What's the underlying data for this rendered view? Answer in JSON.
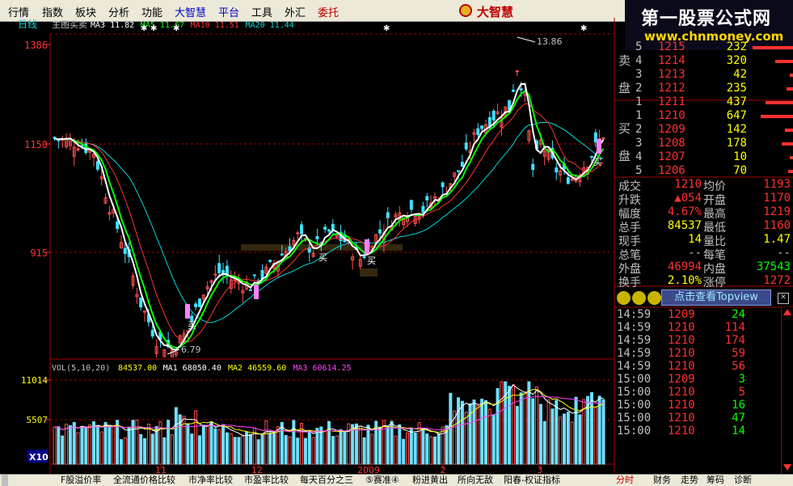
{
  "menu": [
    "行情",
    "指数",
    "板块",
    "分析",
    "功能",
    "大智慧",
    "平台",
    "工具",
    "外汇",
    "委托"
  ],
  "brand": "大智慧",
  "watermark": {
    "line1": "第一股票公式网",
    "line2": "www.chnmoney.com"
  },
  "chart_data": [
    {
      "type": "line",
      "panel": "price",
      "period_label": "日线",
      "title": "主图买卖",
      "legend": [
        {
          "name": "MA3",
          "value": "11.82",
          "color": "#ffffff"
        },
        {
          "name": "MA5",
          "value": "11.67",
          "color": "#00ff00"
        },
        {
          "name": "MA10",
          "value": "11.51",
          "color": "#ff3030"
        },
        {
          "name": "MA20",
          "value": "11.44",
          "color": "#00d8d8"
        }
      ],
      "y_ticks": [
        "1386",
        "1150",
        "915"
      ],
      "high_label": "13.86",
      "low_label": "6.79",
      "signal_label": "买",
      "x_ticks": [
        "11",
        "12",
        "2009",
        "2",
        "3"
      ]
    },
    {
      "type": "bar",
      "panel": "volume",
      "title": "VOL(5,10,20)",
      "legend": [
        {
          "name": "",
          "value": "84537.00",
          "color": "#ffff00"
        },
        {
          "name": "MA1",
          "value": "68050.40",
          "color": "#ffffff"
        },
        {
          "name": "MA2",
          "value": "46559.60",
          "color": "#ffff00"
        },
        {
          "name": "MA3",
          "value": "60614.25",
          "color": "#ff40ff"
        }
      ],
      "y_ticks": [
        "11014",
        "5507"
      ],
      "unit": "X10",
      "ylim": [
        0,
        11014
      ]
    }
  ],
  "orderbook": {
    "sell_label": [
      "卖",
      "盘"
    ],
    "buy_label": [
      "买",
      "盘"
    ],
    "sell": [
      {
        "level": "5",
        "price": "1215",
        "vol": "232"
      },
      {
        "level": "4",
        "price": "1214",
        "vol": "320"
      },
      {
        "level": "3",
        "price": "1213",
        "vol": "42"
      },
      {
        "level": "2",
        "price": "1212",
        "vol": "235"
      },
      {
        "level": "1",
        "price": "1211",
        "vol": "437"
      }
    ],
    "buy": [
      {
        "level": "1",
        "price": "1210",
        "vol": "647"
      },
      {
        "level": "2",
        "price": "1209",
        "vol": "142"
      },
      {
        "level": "3",
        "price": "1208",
        "vol": "178"
      },
      {
        "level": "4",
        "price": "1207",
        "vol": "10"
      },
      {
        "level": "5",
        "price": "1206",
        "vol": "70"
      }
    ]
  },
  "stats": [
    {
      "l1": "成交",
      "v1": "1210",
      "c1": "#ff3030",
      "l2": "均价",
      "v2": "1193",
      "c2": "#ff3030"
    },
    {
      "l1": "升跌",
      "v1": "▲054",
      "c1": "#ff3030",
      "l2": "开盘",
      "v2": "1170",
      "c2": "#ff3030"
    },
    {
      "l1": "幅度",
      "v1": "4.67%",
      "c1": "#ff3030",
      "l2": "最高",
      "v2": "1219",
      "c2": "#ff3030"
    },
    {
      "l1": "总手",
      "v1": "84537",
      "c1": "#ffff00",
      "l2": "最低",
      "v2": "1160",
      "c2": "#ff3030"
    },
    {
      "l1": "现手",
      "v1": "14",
      "c1": "#ffff00",
      "l2": "量比",
      "v2": "1.47",
      "c2": "#ffff00"
    },
    {
      "l1": "总笔",
      "v1": "--",
      "c1": "#c0c0c0",
      "l2": "每笔",
      "v2": "--",
      "c2": "#c0c0c0"
    },
    {
      "l1": "外盘",
      "v1": "46994",
      "c1": "#ff3030",
      "l2": "内盘",
      "v2": "37543",
      "c2": "#00ff00"
    },
    {
      "l1": "换手",
      "v1": "2.10%",
      "c1": "#ffff00",
      "l2": "涨停",
      "v2": "1272",
      "c2": "#ff3030"
    }
  ],
  "topview_label": "点击查看Topview",
  "ticks": [
    {
      "time": "14:59",
      "price": "1209",
      "vol": "24",
      "vc": "#00ff00"
    },
    {
      "time": "14:59",
      "price": "1210",
      "vol": "114",
      "vc": "#ff3030"
    },
    {
      "time": "14:59",
      "price": "1210",
      "vol": "174",
      "vc": "#ff3030"
    },
    {
      "time": "14:59",
      "price": "1210",
      "vol": "59",
      "vc": "#ff3030"
    },
    {
      "time": "14:59",
      "price": "1210",
      "vol": "56",
      "vc": "#ff3030"
    },
    {
      "time": "15:00",
      "price": "1209",
      "vol": "3",
      "vc": "#00ff00"
    },
    {
      "time": "15:00",
      "price": "1210",
      "vol": "5",
      "vc": "#ff3030"
    },
    {
      "time": "15:00",
      "price": "1210",
      "vol": "16",
      "vc": "#00ff00"
    },
    {
      "time": "15:00",
      "price": "1210",
      "vol": "47",
      "vc": "#00ff00"
    },
    {
      "time": "15:00",
      "price": "1210",
      "vol": "14",
      "vc": "#00ff00"
    }
  ],
  "bottom_tabs": [
    "F股溢价率",
    "全流通价格比较",
    "市净率比较",
    "市盈率比较",
    "每天百分之三",
    "⑤赛准④",
    "粉进黄出",
    "所向无敌",
    "阳春-权证指标"
  ],
  "right_tabs": [
    "分时",
    "财务",
    "走势",
    "筹码",
    "诊断"
  ]
}
